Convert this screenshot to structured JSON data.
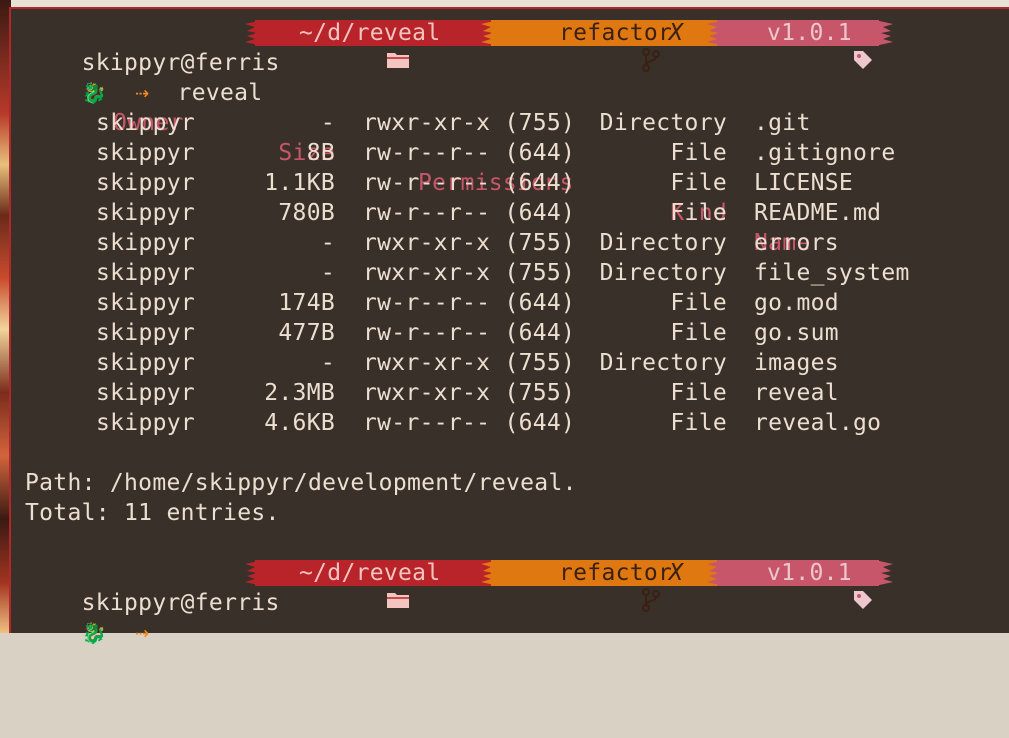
{
  "prompt": {
    "user_host": "skippyr@ferris",
    "dir_icon": "folder-icon",
    "dir": "~/d/reveal",
    "branch_icon": "git-branch-icon",
    "branch": "refactor",
    "dirty_mark": "X",
    "tag_icon": "tag-icon",
    "tag": "v1.0.1",
    "dragon_icon": "dragon-icon",
    "arrow": "⇢",
    "command": "reveal"
  },
  "table": {
    "headers": [
      "Owner",
      "Size",
      "Permissions",
      "Kind",
      "Name"
    ],
    "rows": [
      {
        "owner": "skippyr",
        "size": "-",
        "perm": "rwxr-xr-x (755)",
        "kind": "Directory",
        "name": ".git"
      },
      {
        "owner": "skippyr",
        "size": "8B",
        "perm": "rw-r--r-- (644)",
        "kind": "File",
        "name": ".gitignore"
      },
      {
        "owner": "skippyr",
        "size": "1.1KB",
        "perm": "rw-r--r-- (644)",
        "kind": "File",
        "name": "LICENSE"
      },
      {
        "owner": "skippyr",
        "size": "780B",
        "perm": "rw-r--r-- (644)",
        "kind": "File",
        "name": "README.md"
      },
      {
        "owner": "skippyr",
        "size": "-",
        "perm": "rwxr-xr-x (755)",
        "kind": "Directory",
        "name": "errors"
      },
      {
        "owner": "skippyr",
        "size": "-",
        "perm": "rwxr-xr-x (755)",
        "kind": "Directory",
        "name": "file_system"
      },
      {
        "owner": "skippyr",
        "size": "174B",
        "perm": "rw-r--r-- (644)",
        "kind": "File",
        "name": "go.mod"
      },
      {
        "owner": "skippyr",
        "size": "477B",
        "perm": "rw-r--r-- (644)",
        "kind": "File",
        "name": "go.sum"
      },
      {
        "owner": "skippyr",
        "size": "-",
        "perm": "rwxr-xr-x (755)",
        "kind": "Directory",
        "name": "images"
      },
      {
        "owner": "skippyr",
        "size": "2.3MB",
        "perm": "rwxr-xr-x (755)",
        "kind": "File",
        "name": "reveal"
      },
      {
        "owner": "skippyr",
        "size": "4.6KB",
        "perm": "rw-r--r-- (644)",
        "kind": "File",
        "name": "reveal.go"
      }
    ]
  },
  "summary": {
    "path": "Path: /home/skippyr/development/reveal.",
    "total": "Total: 11 entries."
  },
  "colors": {
    "background": "#3a302a",
    "text": "#ecdfd0",
    "header": "#c8566a",
    "dir_segment": "#b8242a",
    "branch_segment": "#e07812",
    "tag_segment": "#c8566a",
    "arrow": "#f08a1c"
  }
}
